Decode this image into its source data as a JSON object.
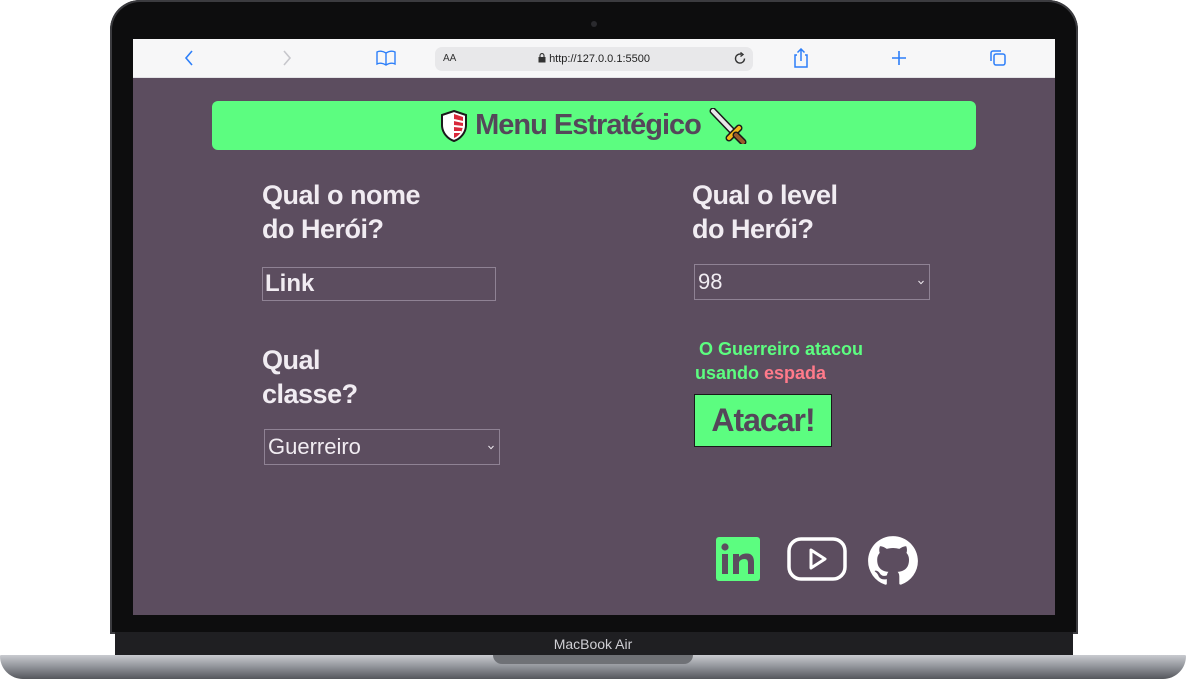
{
  "device": {
    "label": "MacBook Air"
  },
  "browser": {
    "text_size_label": "AA",
    "url": "http://127.0.0.1:5500"
  },
  "page": {
    "banner": {
      "title": "Menu Estratégico"
    },
    "hero_name": {
      "question_line1": "Qual o nome",
      "question_line2": "do Herói?",
      "value": "Link"
    },
    "hero_level": {
      "question_line1": "Qual o level",
      "question_line2": "do Herói?",
      "selected": "98"
    },
    "hero_class": {
      "question_line1": "Qual",
      "question_line2": "classe?",
      "selected": "Guerreiro"
    },
    "result": {
      "part1": "O Guerreiro atacou",
      "part2": "usando",
      "weapon": "espada"
    },
    "attack_button": "Atacar!",
    "social": [
      {
        "icon": "linkedin-icon",
        "label": "in"
      },
      {
        "icon": "youtube-icon"
      },
      {
        "icon": "github-icon"
      }
    ]
  },
  "colors": {
    "page_bg": "#5c4d5f",
    "accent_green": "#5cfd80",
    "weapon_red": "#ff7a8a",
    "text": "#f1ecf2"
  }
}
